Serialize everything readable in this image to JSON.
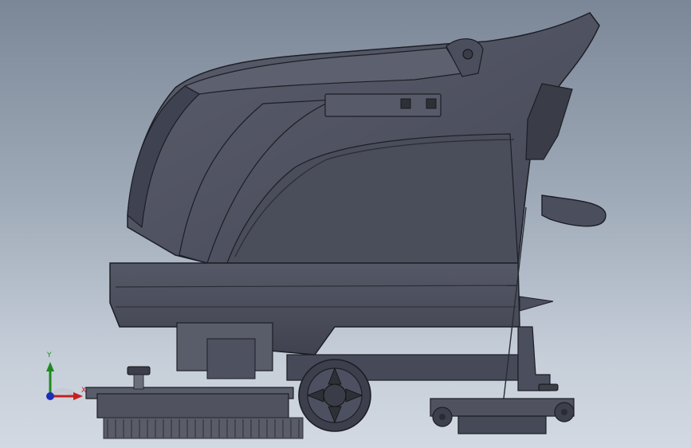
{
  "viewport": {
    "background_top": "#7b8797",
    "background_bottom": "#d2d9e2"
  },
  "model": {
    "body_color": "#4b4e5c",
    "edge_color": "#1c1e26"
  },
  "triad": {
    "y_label": "Y",
    "x_label": "X",
    "y_axis_color": "#1f8a1f",
    "x_axis_color": "#c81e1e",
    "z_axis_color": "#1a2fb8"
  }
}
